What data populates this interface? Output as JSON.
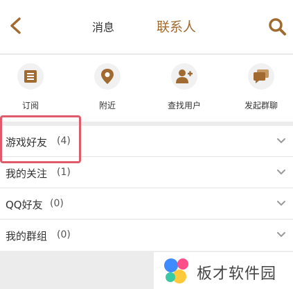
{
  "header": {
    "back_icon": "chevron-left-icon",
    "tabs": [
      {
        "label": "消息"
      },
      {
        "label": "联系人"
      }
    ],
    "search_icon": "search-icon",
    "accent": "#a06a30"
  },
  "actions": [
    {
      "label": "订阅",
      "icon": "subscription-icon"
    },
    {
      "label": "附近",
      "icon": "location-pin-icon"
    },
    {
      "label": "查找用户",
      "icon": "add-user-icon"
    },
    {
      "label": "发起群聊",
      "icon": "chat-bubbles-icon"
    }
  ],
  "groups": [
    {
      "name": "游戏好友",
      "count": "(4)"
    },
    {
      "name": "我的关注",
      "count": "(1)"
    },
    {
      "name": "QQ好友",
      "count": "(0)"
    },
    {
      "name": "我的群组",
      "count": "(0)"
    }
  ],
  "highlight_color": "#e05b6a",
  "watermark": {
    "text": "板才软件园"
  }
}
